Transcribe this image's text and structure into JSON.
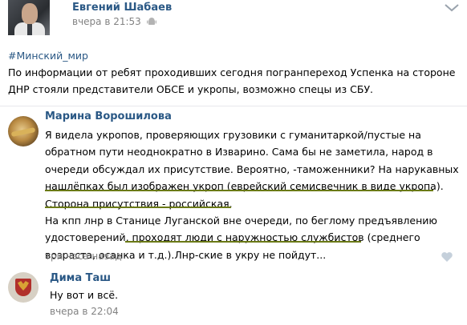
{
  "post": {
    "author": "Евгений Шабаев",
    "time": "вчера в 21:53",
    "hashtag": "#Минский_мир",
    "text": "По информации от ребят проходивших сегодня погранпереход Успенка на стороне ДНР стояли представители ОБСЕ и укропы, возможно спецы из СБУ."
  },
  "comments": [
    {
      "author": "Марина Ворошилова",
      "lines": [
        "Я видела укропов, проверяющих грузовики с гуманитаркой/пустые на",
        "обратном пути неоднократно в Изварино. Сама бы не заметила, народ в",
        "очереди обсуждал их присутствие. Вероятно, -таможенники? На нарукавных",
        "нашлёпках был изображен укроп (еврейский семисвечник в виде укропа).",
        "Сторона присутствия - российская.",
        "На кпп лнр в Станице Луганской вне очереди, по беглому предъявлению",
        "удостоверений, проходят люди с наружностью службистов (среднего",
        "возраста, осанка и т.д.).Лнр-ские в укру не пойдут..."
      ],
      "time": "три часа назад"
    },
    {
      "author": "Дима Таш",
      "text": "Ну вот и всё.",
      "time": "вчера в 22:04"
    }
  ],
  "icons": {
    "platform": "android-icon",
    "menu": "chevron-down-icon",
    "like": "heart-icon"
  },
  "colors": {
    "link": "#2a5885",
    "meta": "#828282",
    "underline": "#6b7a16"
  }
}
